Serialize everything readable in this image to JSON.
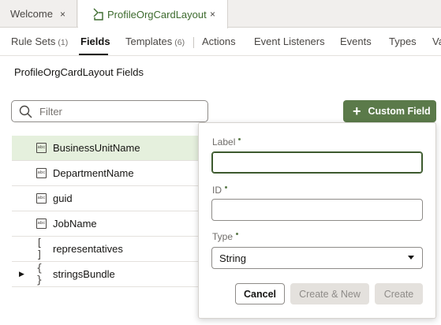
{
  "doc_tabs": [
    {
      "label": "Welcome",
      "close": "×"
    },
    {
      "label": "ProfileOrgCardLayout",
      "close": "×"
    }
  ],
  "subnav": {
    "rule_sets": {
      "label": "Rule Sets",
      "count": "(1)"
    },
    "fields": {
      "label": "Fields"
    },
    "templates": {
      "label": "Templates",
      "count": "(6)"
    },
    "actions": {
      "label": "Actions"
    },
    "event_listeners": {
      "label": "Event Listeners"
    },
    "events": {
      "label": "Events"
    },
    "types": {
      "label": "Types"
    },
    "variables": {
      "label": "Va"
    }
  },
  "section_title": "ProfileOrgCardLayout Fields",
  "filter": {
    "placeholder": "Filter",
    "value": ""
  },
  "custom_field_button": {
    "plus": "+",
    "label": "Custom Field"
  },
  "fields": [
    {
      "label": "BusinessUnitName",
      "icon": "abc"
    },
    {
      "label": "DepartmentName",
      "icon": "abc"
    },
    {
      "label": "guid",
      "icon": "abc"
    },
    {
      "label": "JobName",
      "icon": "abc"
    },
    {
      "label": "representatives",
      "icon": "[ ]"
    },
    {
      "label": "stringsBundle",
      "icon": "{ }"
    }
  ],
  "form": {
    "label_field": {
      "label": "Label",
      "value": ""
    },
    "id_field": {
      "label": "ID",
      "value": ""
    },
    "type_field": {
      "label": "Type",
      "value": "String"
    },
    "cancel": "Cancel",
    "create_new": "Create & New",
    "create": "Create"
  },
  "colors": {
    "accent": "#5b7a4a",
    "selected_row": "#e5f0dd",
    "active_tab_text": "#3d6b2e"
  }
}
